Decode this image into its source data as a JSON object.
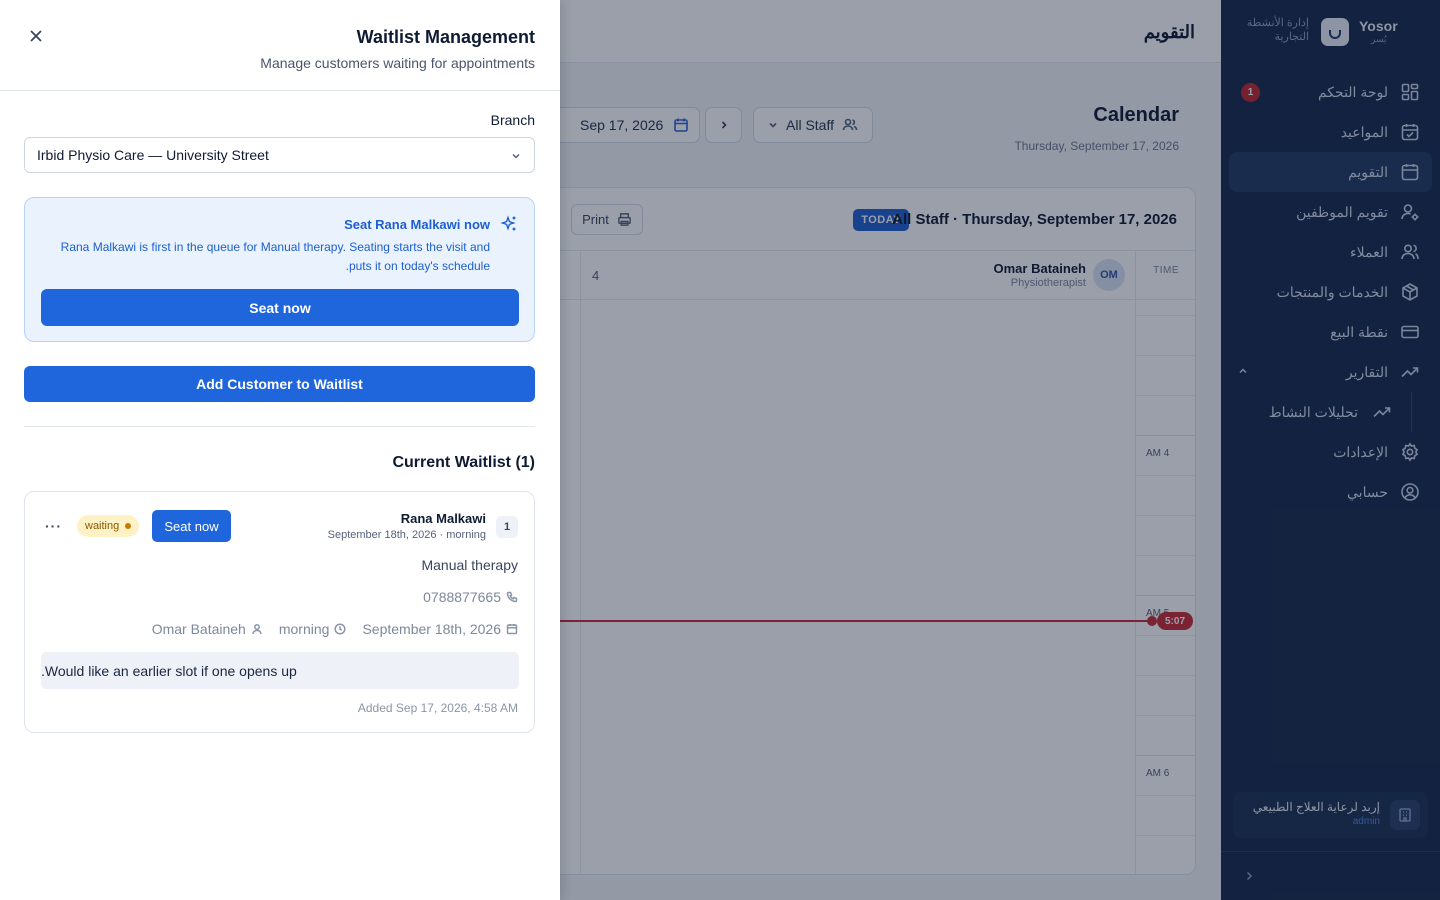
{
  "sidebar": {
    "brand_en": "Yosor",
    "brand_ar": "يُسر",
    "brand_desc": "إدارة الأنشطة التجارية",
    "items": [
      {
        "label": "لوحة التحكم",
        "icon": "dashboard-icon",
        "badge": "1"
      },
      {
        "label": "المواعيد",
        "icon": "calendar-check-icon"
      },
      {
        "label": "التقويم",
        "icon": "calendar-icon",
        "active": true
      },
      {
        "label": "تقويم الموظفين",
        "icon": "user-cog-icon"
      },
      {
        "label": "العملاء",
        "icon": "users-icon"
      },
      {
        "label": "الخدمات والمنتجات",
        "icon": "package-icon"
      },
      {
        "label": "نقطة البيع",
        "icon": "credit-card-icon"
      },
      {
        "label": "التقارير",
        "icon": "trending-up-icon",
        "expanded": true
      },
      {
        "label": "تحليلات النشاط",
        "icon": "trending-up-icon",
        "sub": true
      },
      {
        "label": "الإعدادات",
        "icon": "gear-icon"
      },
      {
        "label": "حسابي",
        "icon": "user-circle-icon"
      }
    ],
    "org_name": "إربد لرعاية العلاج الطبيعي",
    "org_role": "admin"
  },
  "main": {
    "topbar_title": "التقويم",
    "calendar_title": "Calendar",
    "calendar_subtitle": "Thursday, September 17, 2026",
    "date_value": "Sep 17, 2026",
    "staff_filter": "All Staff",
    "today_badge": "TODAY",
    "panel_title": "All Staff · Thursday, September 17, 2026",
    "print_label": "Print",
    "time_header": "TIME",
    "staff": {
      "initials": "OM",
      "name": "Omar Bataineh",
      "role": "Physiotherapist"
    },
    "column_number": "4",
    "hour_labels": [
      "AM 4",
      "AM 5",
      "AM 6"
    ],
    "now_time": "5:07"
  },
  "drawer": {
    "title": "Waitlist Management",
    "subtitle": "Manage customers waiting for appointments",
    "branch_label": "Branch",
    "branch_value": "Irbid Physio Care — University Street",
    "hint_title": "Seat Rana Malkawi now",
    "hint_text": "Rana Malkawi is first in the queue for Manual therapy. Seating starts the visit and puts it on today's schedule.",
    "hint_button": "Seat now",
    "add_button": "Add Customer to Waitlist",
    "section_title": "Current Waitlist (1)",
    "entries": [
      {
        "position": "1",
        "name": "Rana Malkawi",
        "when": "September 18th, 2026 · morning",
        "seat_label": "Seat now",
        "status": "waiting",
        "service": "Manual therapy",
        "phone": "0788877665",
        "date": "September 18th, 2026",
        "period": "morning",
        "staff": "Omar Bataineh",
        "note": "Would like an earlier slot if one opens up.",
        "added": "Added Sep 17, 2026, 4:58 AM"
      }
    ]
  },
  "colors": {
    "primary": "#1f66dd",
    "sidebar": "#16294a",
    "now_line": "#c92a35",
    "status_waiting": "#fdf1c6"
  }
}
